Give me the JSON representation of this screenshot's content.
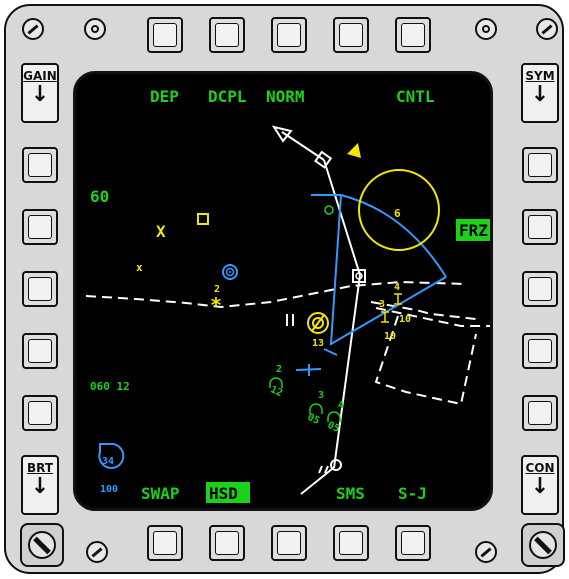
{
  "colors": {
    "green": "#19d219",
    "yellow": "#f2e600",
    "blue": "#3399ff",
    "white": "#ffffff",
    "background": "#000000"
  },
  "rockers": {
    "gain": "GAIN",
    "sym": "SYM",
    "brt": "BRT",
    "con": "CON",
    "arrow": "↓"
  },
  "top_labels": {
    "dep": "DEP",
    "dcpl": "DCPL",
    "norm": "NORM",
    "cntl": "CNTL"
  },
  "bottom_labels": {
    "swap": "SWAP",
    "hsd": "HSD",
    "sms": "SMS",
    "sj": "S-J"
  },
  "side_labels": {
    "range": "60",
    "frz": "FRZ",
    "bullseye": "060 12"
  },
  "threats": {
    "ring_label": "6",
    "sam_label": "13",
    "awacs_badge": "34",
    "awacs_value": "100"
  },
  "markers": {
    "x1": "X",
    "x2": "x",
    "star_num": "2"
  },
  "tracks": {
    "t_a": "4",
    "t_b": "3",
    "t_c": "10",
    "t_d": "10",
    "g_a": "2",
    "g_b": "12",
    "g_c": "3",
    "g_d": "05",
    "g_e": "4",
    "g_f": "05"
  }
}
